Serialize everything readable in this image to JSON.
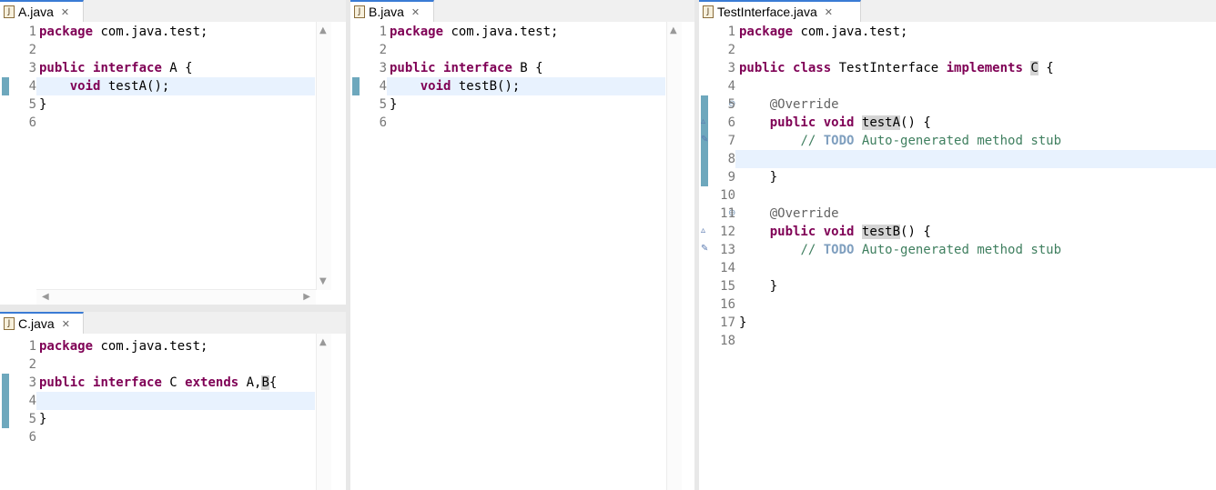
{
  "colors": {
    "keyword": "#7f0055",
    "annotation": "#646464",
    "comment": "#3f7f5f",
    "todo_tag": "#7f9fbf",
    "current_line": "#e8f2fe",
    "change_marker": "#6ea8bd"
  },
  "panes": {
    "a": {
      "tab": "A.java",
      "lines": [
        {
          "n": "1",
          "parts": [
            {
              "t": "package",
              "c": "kw"
            },
            {
              "t": " com.java.test;"
            }
          ]
        },
        {
          "n": "2",
          "parts": []
        },
        {
          "n": "3",
          "parts": [
            {
              "t": "public",
              "c": "kw"
            },
            {
              "t": " "
            },
            {
              "t": "interface",
              "c": "kw"
            },
            {
              "t": " A {"
            }
          ]
        },
        {
          "n": "4",
          "parts": [
            {
              "t": "    "
            },
            {
              "t": "void",
              "c": "kw"
            },
            {
              "t": " testA();"
            }
          ]
        },
        {
          "n": "5",
          "parts": [
            {
              "t": "}"
            }
          ]
        },
        {
          "n": "6",
          "parts": []
        }
      ]
    },
    "b": {
      "tab": "B.java",
      "lines": [
        {
          "n": "1",
          "parts": [
            {
              "t": "package",
              "c": "kw"
            },
            {
              "t": " com.java.test;"
            }
          ]
        },
        {
          "n": "2",
          "parts": []
        },
        {
          "n": "3",
          "parts": [
            {
              "t": "public",
              "c": "kw"
            },
            {
              "t": " "
            },
            {
              "t": "interface",
              "c": "kw"
            },
            {
              "t": " B {"
            }
          ]
        },
        {
          "n": "4",
          "parts": [
            {
              "t": "    "
            },
            {
              "t": "void",
              "c": "kw"
            },
            {
              "t": " testB();"
            }
          ]
        },
        {
          "n": "5",
          "parts": [
            {
              "t": "}"
            }
          ]
        },
        {
          "n": "6",
          "parts": []
        }
      ]
    },
    "c": {
      "tab": "C.java",
      "lines": [
        {
          "n": "1",
          "parts": [
            {
              "t": "package",
              "c": "kw"
            },
            {
              "t": " com.java.test;"
            }
          ]
        },
        {
          "n": "2",
          "parts": []
        },
        {
          "n": "3",
          "parts": [
            {
              "t": "public",
              "c": "kw"
            },
            {
              "t": " "
            },
            {
              "t": "interface",
              "c": "kw"
            },
            {
              "t": " C "
            },
            {
              "t": "extends",
              "c": "kw"
            },
            {
              "t": " A,"
            },
            {
              "t": "B",
              "c": "hl-word"
            },
            {
              "t": "{"
            }
          ]
        },
        {
          "n": "4",
          "parts": []
        },
        {
          "n": "5",
          "parts": [
            {
              "t": "}"
            }
          ]
        },
        {
          "n": "6",
          "parts": []
        }
      ]
    },
    "test": {
      "tab": "TestInterface.java",
      "lines": [
        {
          "n": "1",
          "parts": [
            {
              "t": "package",
              "c": "kw"
            },
            {
              "t": " com.java.test;"
            }
          ]
        },
        {
          "n": "2",
          "parts": []
        },
        {
          "n": "3",
          "parts": [
            {
              "t": "public",
              "c": "kw"
            },
            {
              "t": " "
            },
            {
              "t": "class",
              "c": "kw"
            },
            {
              "t": " TestInterface "
            },
            {
              "t": "implements",
              "c": "kw"
            },
            {
              "t": " "
            },
            {
              "t": "C",
              "c": "hl-word"
            },
            {
              "t": " {"
            }
          ]
        },
        {
          "n": "4",
          "parts": []
        },
        {
          "n": "5",
          "parts": [
            {
              "t": "    "
            },
            {
              "t": "@Override",
              "c": "ann"
            }
          ]
        },
        {
          "n": "6",
          "parts": [
            {
              "t": "    "
            },
            {
              "t": "public",
              "c": "kw"
            },
            {
              "t": " "
            },
            {
              "t": "void",
              "c": "kw"
            },
            {
              "t": " "
            },
            {
              "t": "testA",
              "c": "hl-word"
            },
            {
              "t": "() {"
            }
          ]
        },
        {
          "n": "7",
          "parts": [
            {
              "t": "        "
            },
            {
              "t": "// ",
              "c": "cmt"
            },
            {
              "t": "TODO",
              "c": "todo"
            },
            {
              "t": " Auto-generated method stub",
              "c": "cmt"
            }
          ]
        },
        {
          "n": "8",
          "parts": []
        },
        {
          "n": "9",
          "parts": [
            {
              "t": "    }"
            }
          ]
        },
        {
          "n": "10",
          "parts": []
        },
        {
          "n": "11",
          "parts": [
            {
              "t": "    "
            },
            {
              "t": "@Override",
              "c": "ann"
            }
          ]
        },
        {
          "n": "12",
          "parts": [
            {
              "t": "    "
            },
            {
              "t": "public",
              "c": "kw"
            },
            {
              "t": " "
            },
            {
              "t": "void",
              "c": "kw"
            },
            {
              "t": " "
            },
            {
              "t": "testB",
              "c": "hl-word"
            },
            {
              "t": "() {"
            }
          ]
        },
        {
          "n": "13",
          "parts": [
            {
              "t": "        "
            },
            {
              "t": "// ",
              "c": "cmt"
            },
            {
              "t": "TODO",
              "c": "todo"
            },
            {
              "t": " Auto-generated method stub",
              "c": "cmt"
            }
          ]
        },
        {
          "n": "14",
          "parts": []
        },
        {
          "n": "15",
          "parts": [
            {
              "t": "    }"
            }
          ]
        },
        {
          "n": "16",
          "parts": []
        },
        {
          "n": "17",
          "parts": [
            {
              "t": "}"
            }
          ]
        },
        {
          "n": "18",
          "parts": []
        }
      ]
    }
  }
}
